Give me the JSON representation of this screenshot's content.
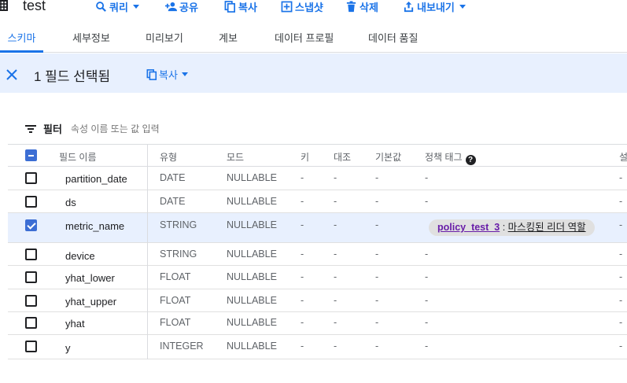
{
  "header": {
    "title": "test",
    "actions": [
      {
        "label": "쿼리",
        "icon": "search-icon"
      },
      {
        "label": "공유",
        "icon": "person-add-icon"
      },
      {
        "label": "복사",
        "icon": "copy-icon"
      },
      {
        "label": "스냅샷",
        "icon": "snapshot-icon"
      },
      {
        "label": "삭제",
        "icon": "trash-icon"
      },
      {
        "label": "내보내기",
        "icon": "export-icon"
      }
    ]
  },
  "tabs": [
    {
      "label": "스키마",
      "active": true
    },
    {
      "label": "세부정보"
    },
    {
      "label": "미리보기"
    },
    {
      "label": "계보"
    },
    {
      "label": "데이터 프로필"
    },
    {
      "label": "데이터 품질"
    }
  ],
  "selection_bar": {
    "count_text": "1 필드 선택됨",
    "copy_label": "복사"
  },
  "filter": {
    "label": "필터",
    "placeholder": "속성 이름 또는 값 입력"
  },
  "columns": {
    "field_name": "필드 이름",
    "type": "유형",
    "mode": "모드",
    "key": "키",
    "collation": "대조",
    "default": "기본값",
    "policy_tags": "정책 태그",
    "description": "설"
  },
  "rows": [
    {
      "name": "partition_date",
      "type": "DATE",
      "mode": "NULLABLE",
      "key": "-",
      "collation": "-",
      "default": "-",
      "policy": "-",
      "description": "-",
      "checked": false
    },
    {
      "name": "ds",
      "type": "DATE",
      "mode": "NULLABLE",
      "key": "-",
      "collation": "-",
      "default": "-",
      "policy": "-",
      "description": "-",
      "checked": false
    },
    {
      "name": "metric_name",
      "type": "STRING",
      "mode": "NULLABLE",
      "key": "-",
      "collation": "-",
      "default": "-",
      "policy": "",
      "description": "-",
      "checked": true
    },
    {
      "name": "device",
      "type": "STRING",
      "mode": "NULLABLE",
      "key": "-",
      "collation": "-",
      "default": "-",
      "policy": "-",
      "description": "-",
      "checked": false
    },
    {
      "name": "yhat_lower",
      "type": "FLOAT",
      "mode": "NULLABLE",
      "key": "-",
      "collation": "-",
      "default": "-",
      "policy": "-",
      "description": "-",
      "checked": false
    },
    {
      "name": "yhat_upper",
      "type": "FLOAT",
      "mode": "NULLABLE",
      "key": "-",
      "collation": "-",
      "default": "-",
      "policy": "-",
      "description": "-",
      "checked": false
    },
    {
      "name": "yhat",
      "type": "FLOAT",
      "mode": "NULLABLE",
      "key": "-",
      "collation": "-",
      "default": "-",
      "policy": "-",
      "description": "-",
      "checked": false
    },
    {
      "name": "y",
      "type": "INTEGER",
      "mode": "NULLABLE",
      "key": "-",
      "collation": "-",
      "default": "-",
      "policy": "-",
      "description": "-",
      "checked": false
    }
  ],
  "policy_chip": {
    "tag": "policy_test_3",
    "separator": " : ",
    "role": "마스킹된 리더 역할"
  },
  "colors": {
    "accent": "#1a73e8",
    "selection_bg": "#e8f0fe",
    "checkbox_blue": "#3c6ed4",
    "policy_link": "#681da8"
  }
}
